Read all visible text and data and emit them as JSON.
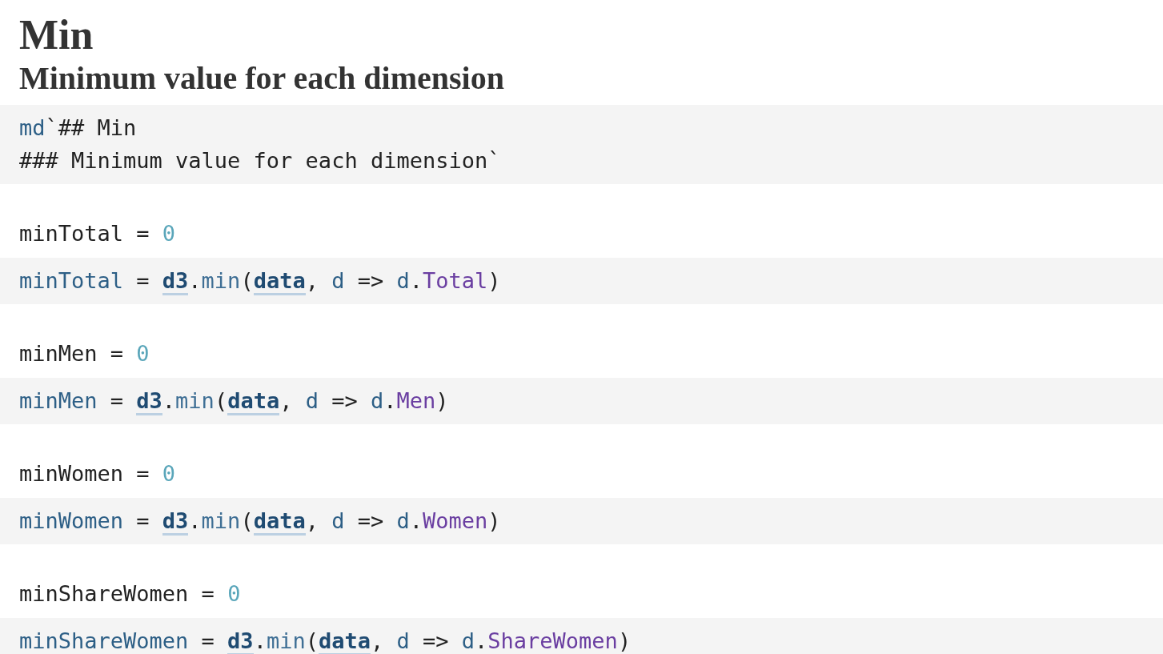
{
  "heading": "Min",
  "subheading": "Minimum value for each dimension",
  "cells": [
    {
      "kind": "code",
      "lines": [
        [
          {
            "t": "md",
            "kind": "variable"
          },
          {
            "t": "`## Min",
            "kind": "plain"
          }
        ],
        [
          {
            "t": "### Minimum value for each dimension`",
            "kind": "plain"
          }
        ]
      ]
    },
    {
      "kind": "output",
      "name": "minTotal",
      "operator": "=",
      "value": "0"
    },
    {
      "kind": "code",
      "lines": [
        [
          {
            "t": "minTotal",
            "kind": "variable"
          },
          {
            "t": " = ",
            "kind": "plain"
          },
          {
            "t": "d3",
            "kind": "reference"
          },
          {
            "t": ".",
            "kind": "plain"
          },
          {
            "t": "min",
            "kind": "method"
          },
          {
            "t": "(",
            "kind": "plain"
          },
          {
            "t": "data",
            "kind": "reference"
          },
          {
            "t": ", ",
            "kind": "plain"
          },
          {
            "t": "d",
            "kind": "param"
          },
          {
            "t": " => ",
            "kind": "plain"
          },
          {
            "t": "d",
            "kind": "param"
          },
          {
            "t": ".",
            "kind": "plain"
          },
          {
            "t": "Total",
            "kind": "property"
          },
          {
            "t": ")",
            "kind": "plain"
          }
        ]
      ]
    },
    {
      "kind": "output",
      "name": "minMen",
      "operator": "=",
      "value": "0"
    },
    {
      "kind": "code",
      "lines": [
        [
          {
            "t": "minMen",
            "kind": "variable"
          },
          {
            "t": " = ",
            "kind": "plain"
          },
          {
            "t": "d3",
            "kind": "reference"
          },
          {
            "t": ".",
            "kind": "plain"
          },
          {
            "t": "min",
            "kind": "method"
          },
          {
            "t": "(",
            "kind": "plain"
          },
          {
            "t": "data",
            "kind": "reference"
          },
          {
            "t": ", ",
            "kind": "plain"
          },
          {
            "t": "d",
            "kind": "param"
          },
          {
            "t": " => ",
            "kind": "plain"
          },
          {
            "t": "d",
            "kind": "param"
          },
          {
            "t": ".",
            "kind": "plain"
          },
          {
            "t": "Men",
            "kind": "property"
          },
          {
            "t": ")",
            "kind": "plain"
          }
        ]
      ]
    },
    {
      "kind": "output",
      "name": "minWomen",
      "operator": "=",
      "value": "0"
    },
    {
      "kind": "code",
      "lines": [
        [
          {
            "t": "minWomen",
            "kind": "variable"
          },
          {
            "t": " = ",
            "kind": "plain"
          },
          {
            "t": "d3",
            "kind": "reference"
          },
          {
            "t": ".",
            "kind": "plain"
          },
          {
            "t": "min",
            "kind": "method"
          },
          {
            "t": "(",
            "kind": "plain"
          },
          {
            "t": "data",
            "kind": "reference"
          },
          {
            "t": ", ",
            "kind": "plain"
          },
          {
            "t": "d",
            "kind": "param"
          },
          {
            "t": " => ",
            "kind": "plain"
          },
          {
            "t": "d",
            "kind": "param"
          },
          {
            "t": ".",
            "kind": "plain"
          },
          {
            "t": "Women",
            "kind": "property"
          },
          {
            "t": ")",
            "kind": "plain"
          }
        ]
      ]
    },
    {
      "kind": "output",
      "name": "minShareWomen",
      "operator": "=",
      "value": "0"
    },
    {
      "kind": "code",
      "lines": [
        [
          {
            "t": "minShareWomen",
            "kind": "variable"
          },
          {
            "t": " = ",
            "kind": "plain"
          },
          {
            "t": "d3",
            "kind": "reference"
          },
          {
            "t": ".",
            "kind": "plain"
          },
          {
            "t": "min",
            "kind": "method"
          },
          {
            "t": "(",
            "kind": "plain"
          },
          {
            "t": "data",
            "kind": "reference"
          },
          {
            "t": ", ",
            "kind": "plain"
          },
          {
            "t": "d",
            "kind": "param"
          },
          {
            "t": " => ",
            "kind": "plain"
          },
          {
            "t": "d",
            "kind": "param"
          },
          {
            "t": ".",
            "kind": "plain"
          },
          {
            "t": "ShareWomen",
            "kind": "property"
          },
          {
            "t": ")",
            "kind": "plain"
          }
        ]
      ]
    }
  ]
}
